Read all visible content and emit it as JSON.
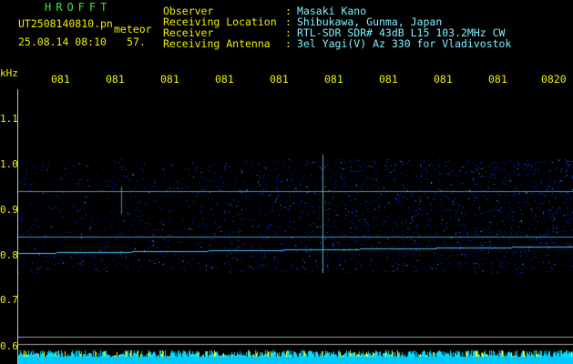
{
  "header": {
    "app_title": "HROFFT",
    "file_name": "UT2508140810.pn",
    "meteor_label": "meteor",
    "date_time": "25.08.14 08:10",
    "count": "57."
  },
  "info": [
    {
      "label": "Observer",
      "sep": ":",
      "value": "Masaki Kano"
    },
    {
      "label": "Receiving Location",
      "sep": ":",
      "value": "Shibukawa, Gunma, Japan"
    },
    {
      "label": "Receiver",
      "sep": ":",
      "value": "RTL-SDR SDR# 43dB L15 103.2MHz CW"
    },
    {
      "label": "Receiving Antenna",
      "sep": ":",
      "value": "3el Yagi(V) Az 330 for Vladivostok"
    }
  ],
  "axis": {
    "y_unit": "kHz",
    "y_ticks": [
      "1.1",
      "1.0",
      "0.9",
      "0.8",
      "0.7",
      "0.6"
    ],
    "time_ticks": [
      "081",
      "081",
      "081",
      "081",
      "081",
      "081",
      "081",
      "081",
      "081",
      "0820"
    ]
  },
  "colors": {
    "background": "#000000",
    "label_yellow": "#f0f000",
    "info_cyan": "#80f0ff",
    "title_green": "#40e040",
    "noise_blue": "#2040ff",
    "signal_cyan": "#80ffff"
  }
}
